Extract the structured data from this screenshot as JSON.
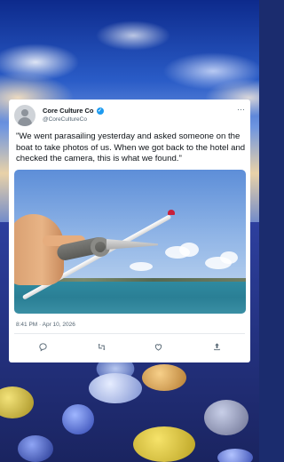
{
  "tweet": {
    "display_name": "Core Culture Co",
    "handle": "@CoreCultureCo",
    "text": "\"We went parasailing yesterday and asked someone on the boat to take photos of us. When we got back to the hotel and checked the camera, this is what we found.\"",
    "timestamp": "8:41 PM · Apr 10, 2026",
    "more_label": "···"
  },
  "actions": [
    "reply-icon",
    "retweet-icon",
    "like-icon",
    "share-icon"
  ],
  "colors": {
    "verified": "#1d9bf0",
    "text": "#0f1419",
    "secondary": "#536471"
  }
}
